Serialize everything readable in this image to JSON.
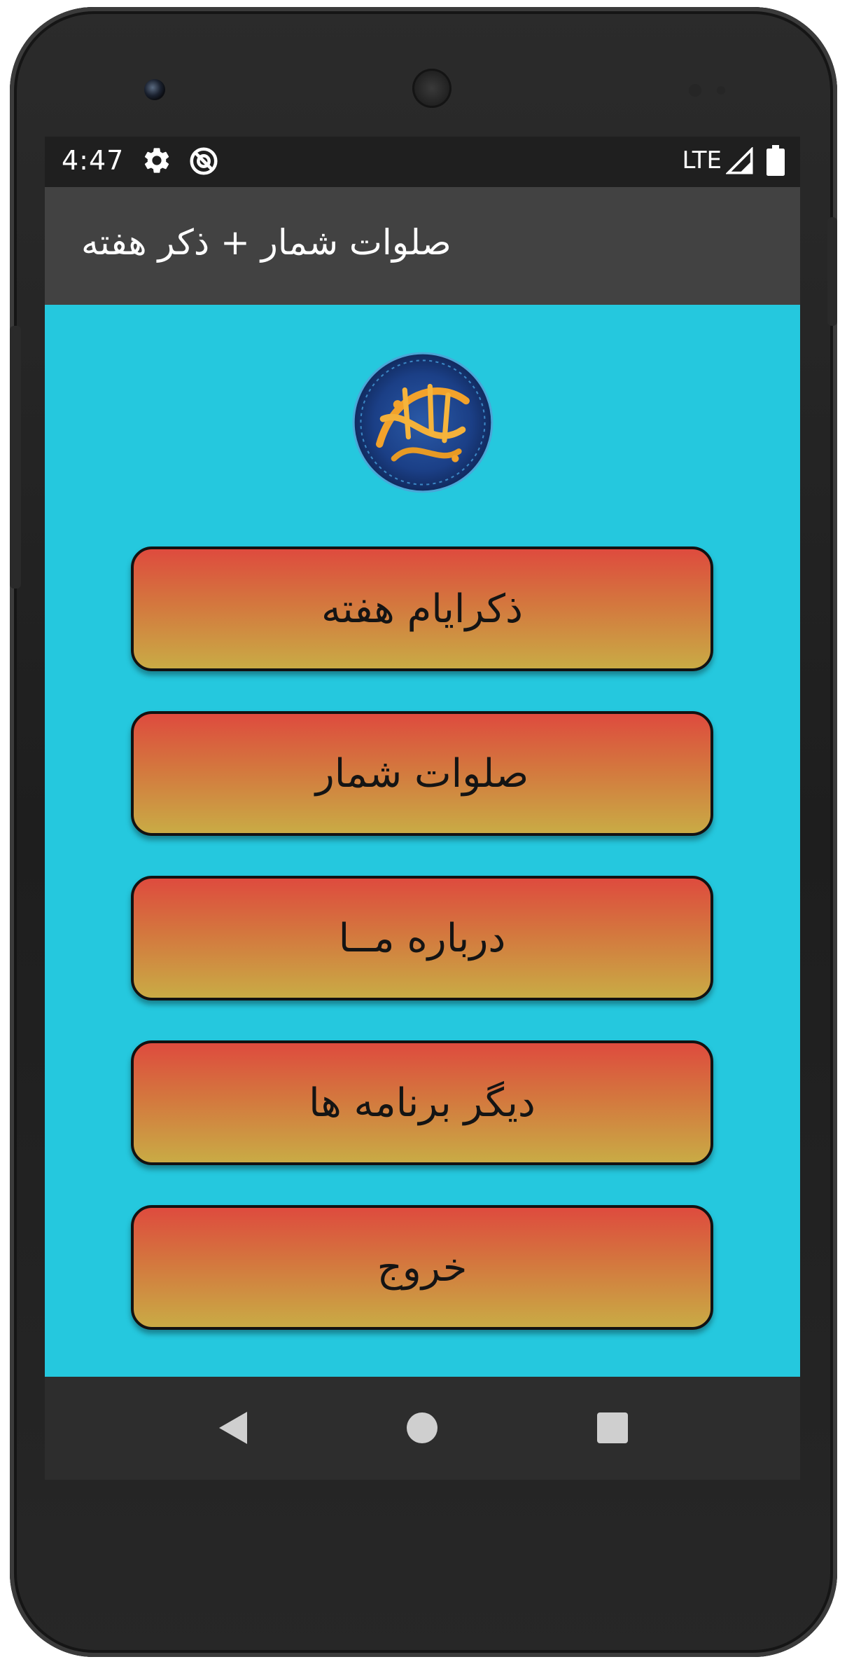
{
  "status_bar": {
    "time": "4:47",
    "network": "LTE",
    "icons": [
      "gear-icon",
      "sync-disabled-icon",
      "signal-icon",
      "battery-icon"
    ]
  },
  "app_bar": {
    "title": "صلوات شمار + ذکر هفته"
  },
  "logo": {
    "icon": "calligraphy-emblem-icon"
  },
  "menu": {
    "buttons": [
      {
        "label": "ذکرایام هفته"
      },
      {
        "label": "صلوات شمار"
      },
      {
        "label": "درباره مــا"
      },
      {
        "label": "دیگر برنامه ها"
      },
      {
        "label": "خروج"
      }
    ]
  },
  "navigation": {
    "icons": [
      "back-icon",
      "home-icon",
      "recents-icon"
    ]
  },
  "colors": {
    "content_background": "#25c8de",
    "button_gradient_top": "#de4b3e",
    "button_gradient_bottom": "#c9ab45",
    "app_bar": "#424242",
    "status_bar": "#1f1f1f",
    "nav_bar": "#2d2d2d"
  }
}
